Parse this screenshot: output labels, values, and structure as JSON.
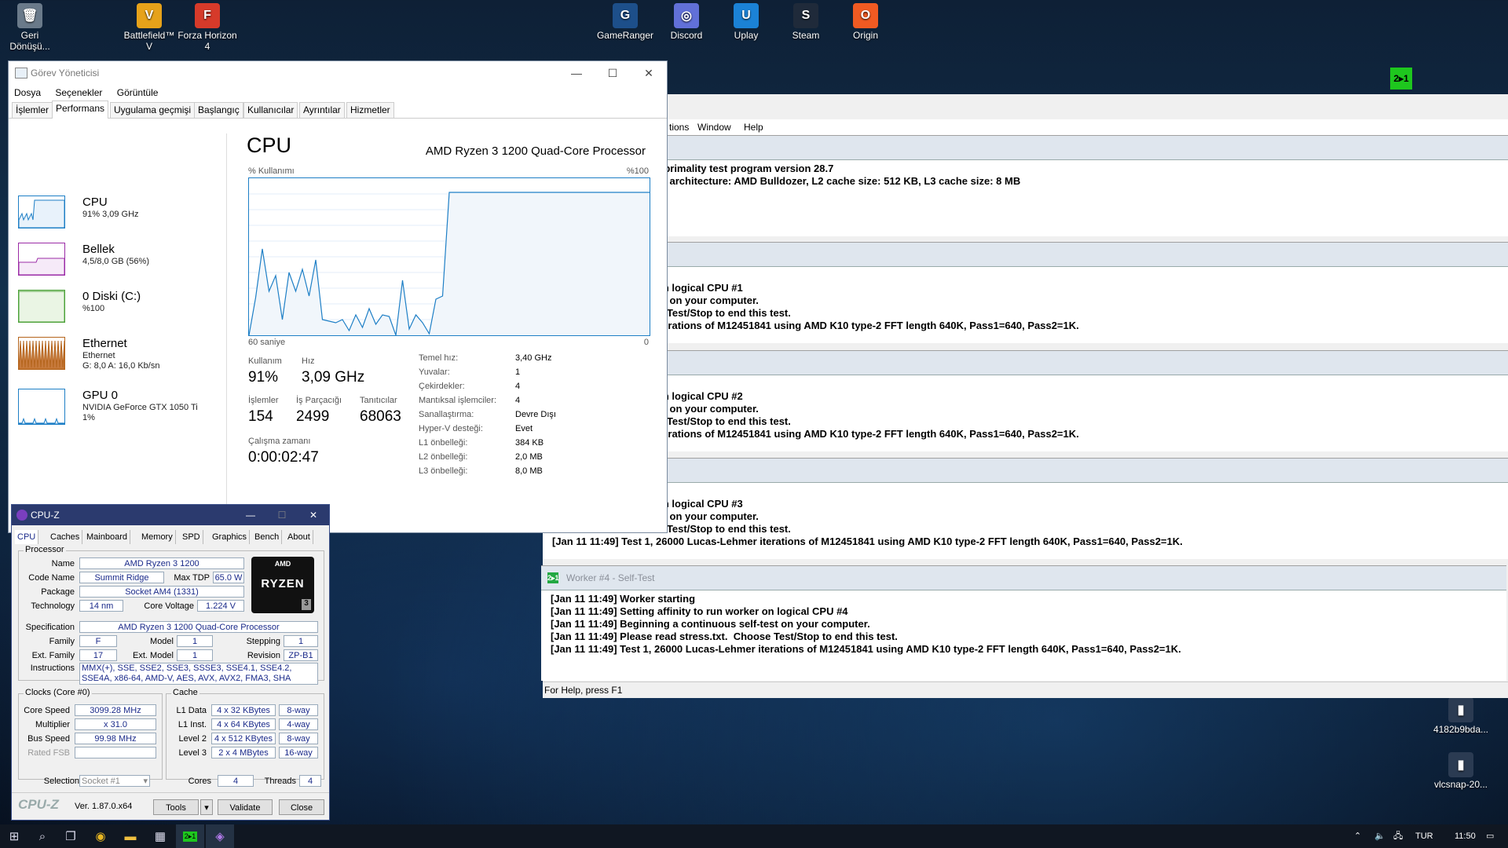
{
  "desktop": {
    "icons": [
      {
        "label": "Geri Dönüşü...",
        "glyph": "🗑",
        "color": "#6a7a8a"
      },
      {
        "label": "Battlefield™ V",
        "glyph": "V",
        "color": "#e6a21a"
      },
      {
        "label": "Forza Horizon 4",
        "glyph": "F",
        "color": "#d63a2a"
      },
      {
        "label": "GameRanger",
        "glyph": "G",
        "color": "#1d4f8a"
      },
      {
        "label": "Discord",
        "glyph": "◎",
        "color": "#6170d8"
      },
      {
        "label": "Uplay",
        "glyph": "U",
        "color": "#1b82d6"
      },
      {
        "label": "Steam",
        "glyph": "S",
        "color": "#1f2a3a"
      },
      {
        "label": "Origin",
        "glyph": "O",
        "color": "#f05a22"
      }
    ],
    "right_icons": [
      {
        "label": "4182b9bda...",
        "glyph": "▮"
      },
      {
        "label": "vlcsnap-20...",
        "glyph": "▮"
      }
    ],
    "prime_badge": "2▸1"
  },
  "prime95": {
    "menu": [
      "tions",
      "Window",
      "Help"
    ],
    "main_lines": [
      ":49] Mersenne number primality test program version 28.7",
      ":49] Optimizing for CPU architecture: AMD Bulldozer, L2 cache size: 512 KB, L3 cache size: 8 MB",
      ":49] Starting workers."
    ],
    "workers": [
      {
        "title": "",
        "lines": [
          "starting",
          "affinity to run worker on logical CPU #1",
          "g a continuous self-test on your computer.",
          "ead stress.txt.  Choose Test/Stop to end this test.",
          "26000 Lucas-Lehmer iterations of M12451841 using AMD K10 type-2 FFT length 640K, Pass1=640, Pass2=1K."
        ]
      },
      {
        "title": "",
        "lines": [
          "starting",
          "affinity to run worker on logical CPU #2",
          "g a continuous self-test on your computer.",
          "ead stress.txt.  Choose Test/Stop to end this test.",
          "26000 Lucas-Lehmer iterations of M12451841 using AMD K10 type-2 FFT length 640K, Pass1=640, Pass2=1K."
        ]
      },
      {
        "title": "",
        "lines": [
          "starting",
          "affinity to run worker on logical CPU #3",
          "g a continuous self-test on your computer.",
          "ead stress.txt.  Choose Test/Stop to end this test.",
          "[Jan 11 11:49] Test 1, 26000 Lucas-Lehmer iterations of M12451841 using AMD K10 type-2 FFT length 640K, Pass1=640, Pass2=1K."
        ]
      },
      {
        "title": "Worker #4 - Self-Test",
        "lines": [
          "[Jan 11 11:49] Worker starting",
          "[Jan 11 11:49] Setting affinity to run worker on logical CPU #4",
          "[Jan 11 11:49] Beginning a continuous self-test on your computer.",
          "[Jan 11 11:49] Please read stress.txt.  Choose Test/Stop to end this test.",
          "[Jan 11 11:49] Test 1, 26000 Lucas-Lehmer iterations of M12451841 using AMD K10 type-2 FFT length 640K, Pass1=640, Pass2=1K."
        ]
      }
    ],
    "status": "For Help, press F1"
  },
  "taskmgr": {
    "title": "Görev Yöneticisi",
    "menu": [
      "Dosya",
      "Seçenekler",
      "Görüntüle"
    ],
    "tabs": [
      "İşlemler",
      "Performans",
      "Uygulama geçmişi",
      "Başlangıç",
      "Kullanıcılar",
      "Ayrıntılar",
      "Hizmetler"
    ],
    "active_tab": 1,
    "sidebar": [
      {
        "name": "CPU",
        "sub1": "91% 3,09 GHz",
        "sub2": "",
        "color": "#1e7fc6"
      },
      {
        "name": "Bellek",
        "sub1": "4,5/8,0 GB (56%)",
        "sub2": "",
        "color": "#9b2ba6"
      },
      {
        "name": "0 Diski (C:)",
        "sub1": "%100",
        "sub2": "",
        "color": "#4da23a"
      },
      {
        "name": "Ethernet",
        "sub1": "Ethernet",
        "sub2": "G: 8,0 A: 16,0 Kb/sn",
        "color": "#b5651d"
      },
      {
        "name": "GPU 0",
        "sub1": "NVIDIA GeForce GTX 1050 Ti",
        "sub2": "1%",
        "color": "#1e7fc6"
      }
    ],
    "cpu": {
      "heading": "CPU",
      "model": "AMD Ryzen 3 1200 Quad-Core Processor",
      "graph_label": "% Kullanımı",
      "graph_max": "%100",
      "graph_time": "60 saniye",
      "graph_zero": "0",
      "usage_points": [
        0,
        24,
        55,
        28,
        38,
        10,
        40,
        28,
        42,
        25,
        48,
        10,
        9,
        8,
        10,
        3,
        13,
        5,
        17,
        7,
        13,
        12,
        0,
        35,
        4,
        13,
        8,
        1,
        23,
        25,
        91,
        91,
        91,
        91,
        91,
        91,
        91,
        91,
        91,
        91,
        91,
        91,
        91,
        91,
        91,
        91,
        91,
        91,
        91,
        91,
        91,
        91,
        91,
        91,
        91,
        91,
        91,
        91,
        91,
        91,
        91
      ],
      "stats": {
        "usage_label": "Kullanım",
        "usage": "91%",
        "speed_label": "Hız",
        "speed": "3,09 GHz",
        "proc_label": "İşlemler",
        "proc": "154",
        "threads_label": "İş Parçacığı",
        "threads": "2499",
        "handles_label": "Tanıtıcılar",
        "handles": "68063",
        "uptime_label": "Çalışma zamanı",
        "uptime": "0:00:02:47"
      },
      "details": [
        [
          "Temel hız:",
          "3,40 GHz"
        ],
        [
          "Yuvalar:",
          "1"
        ],
        [
          "Çekirdekler:",
          "4"
        ],
        [
          "Mantıksal işlemciler:",
          "4"
        ],
        [
          "Sanallaştırma:",
          "Devre Dışı"
        ],
        [
          "Hyper-V desteği:",
          "Evet"
        ],
        [
          "L1 önbelleği:",
          "384 KB"
        ],
        [
          "L2 önbelleği:",
          "2,0 MB"
        ],
        [
          "L3 önbelleği:",
          "8,0 MB"
        ]
      ]
    }
  },
  "cpuz": {
    "title": "CPU-Z",
    "tabs": [
      "CPU",
      "Caches",
      "Mainboard",
      "Memory",
      "SPD",
      "Graphics",
      "Bench",
      "About"
    ],
    "processor_group": "Processor",
    "name_label": "Name",
    "name": "AMD Ryzen 3 1200",
    "codename_label": "Code Name",
    "codename": "Summit Ridge",
    "tdp_label": "Max TDP",
    "tdp": "65.0 W",
    "package_label": "Package",
    "package": "Socket AM4 (1331)",
    "tech_label": "Technology",
    "tech": "14 nm",
    "voltage_label": "Core Voltage",
    "voltage": "1.224 V",
    "spec_label": "Specification",
    "spec": "AMD Ryzen 3 1200 Quad-Core Processor",
    "family_label": "Family",
    "family": "F",
    "model_label": "Model",
    "model": "1",
    "stepping_label": "Stepping",
    "stepping": "1",
    "extfamily_label": "Ext. Family",
    "extfamily": "17",
    "extmodel_label": "Ext. Model",
    "extmodel": "1",
    "revision_label": "Revision",
    "revision": "ZP-B1",
    "instr_label": "Instructions",
    "instr": "MMX(+), SSE, SSE2, SSE3, SSSE3, SSE4.1, SSE4.2, SSE4A, x86-64, AMD-V, AES, AVX, AVX2, FMA3, SHA",
    "logo_top": "AMD",
    "logo_main": "RYZEN",
    "logo_num": "3",
    "clocks_group": "Clocks (Core #0)",
    "corespeed_label": "Core Speed",
    "corespeed": "3099.28 MHz",
    "mult_label": "Multiplier",
    "mult": "x 31.0",
    "bus_label": "Bus Speed",
    "bus": "99.98 MHz",
    "fsb_label": "Rated FSB",
    "fsb": "",
    "cache_group": "Cache",
    "l1d_label": "L1 Data",
    "l1d": "4 x 32 KBytes",
    "l1d_way": "8-way",
    "l1i_label": "L1 Inst.",
    "l1i": "4 x 64 KBytes",
    "l1i_way": "4-way",
    "l2_label": "Level 2",
    "l2": "4 x 512 KBytes",
    "l2_way": "8-way",
    "l3_label": "Level 3",
    "l3": "2 x 4 MBytes",
    "l3_way": "16-way",
    "sel_label": "Selection",
    "sel": "Socket #1",
    "cores_label": "Cores",
    "cores": "4",
    "threads_label": "Threads",
    "threads": "4",
    "brand": "CPU-Z",
    "version": "Ver. 1.87.0.x64",
    "tools": "Tools",
    "validate": "Validate",
    "close": "Close"
  },
  "taskbar": {
    "lang": "TUR",
    "time": "11:50"
  }
}
